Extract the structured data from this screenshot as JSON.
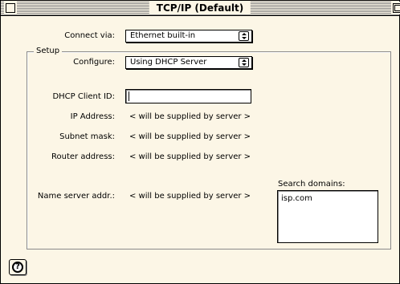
{
  "window": {
    "title": "TCP/IP (Default)"
  },
  "connect_via": {
    "label": "Connect via:",
    "selected": "Ethernet built-in"
  },
  "setup": {
    "legend": "Setup",
    "configure": {
      "label": "Configure:",
      "selected": "Using DHCP Server"
    },
    "dhcp_client_id": {
      "label": "DHCP Client ID:",
      "value": ""
    },
    "ip_address": {
      "label": "IP Address:",
      "value": "< will be supplied by server >"
    },
    "subnet_mask": {
      "label": "Subnet mask:",
      "value": "< will be supplied by server >"
    },
    "router_address": {
      "label": "Router address:",
      "value": "< will be supplied by server >"
    },
    "name_server": {
      "label": "Name server addr.:",
      "value": "< will be supplied by server >"
    },
    "search_domains": {
      "label": "Search domains:",
      "value": "isp.com"
    }
  },
  "icons": {
    "help": "help-icon",
    "close": "close-box-icon",
    "zoom": "zoom-box-icon",
    "popup_arrows": "popup-arrows-icon"
  },
  "help_glyph": "?"
}
